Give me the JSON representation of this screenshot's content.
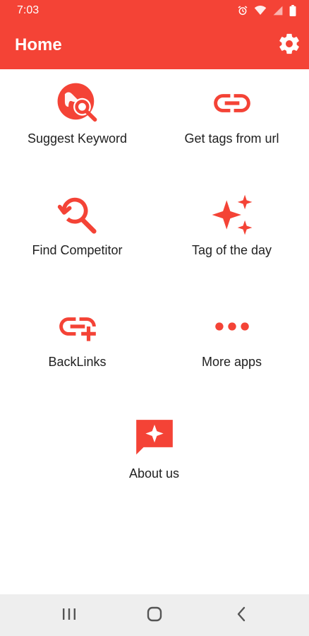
{
  "status_bar": {
    "time": "7:03",
    "icons": [
      "alarm-icon",
      "wifi-icon",
      "signal-icon",
      "battery-icon"
    ]
  },
  "app_bar": {
    "title": "Home",
    "settings_icon": "gear-icon"
  },
  "menu": [
    {
      "label": "Suggest Keyword",
      "icon": "globe-search-icon"
    },
    {
      "label": "Get tags from url",
      "icon": "link-icon"
    },
    {
      "label": "Find Competitor",
      "icon": "search-history-icon"
    },
    {
      "label": "Tag of the day",
      "icon": "sparkles-icon"
    },
    {
      "label": "BackLinks",
      "icon": "add-link-icon"
    },
    {
      "label": "More apps",
      "icon": "more-dots-icon"
    },
    {
      "label": "About us",
      "icon": "chat-star-icon"
    }
  ],
  "nav_bar": {
    "icons": [
      "recents-icon",
      "home-icon",
      "back-icon"
    ]
  },
  "colors": {
    "accent": "#f44336",
    "text": "#212121",
    "nav_background": "#eeeeee"
  }
}
